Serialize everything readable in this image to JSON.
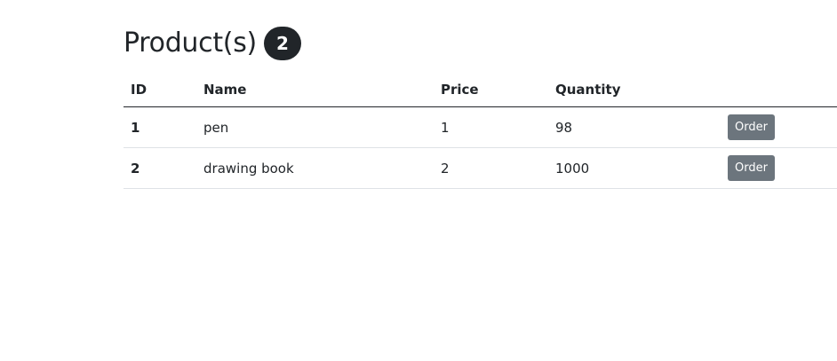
{
  "header": {
    "title": "Product(s)",
    "count": "2"
  },
  "table": {
    "columns": [
      "ID",
      "Name",
      "Price",
      "Quantity",
      ""
    ],
    "rows": [
      {
        "id": "1",
        "name": "pen",
        "price": "1",
        "quantity": "98",
        "action": "Order"
      },
      {
        "id": "2",
        "name": "drawing book",
        "price": "2",
        "quantity": "1000",
        "action": "Order"
      }
    ]
  },
  "colors": {
    "text": "#212529",
    "badge_bg": "#212529",
    "button_bg": "#6c757d",
    "row_border": "#dee2e6"
  }
}
